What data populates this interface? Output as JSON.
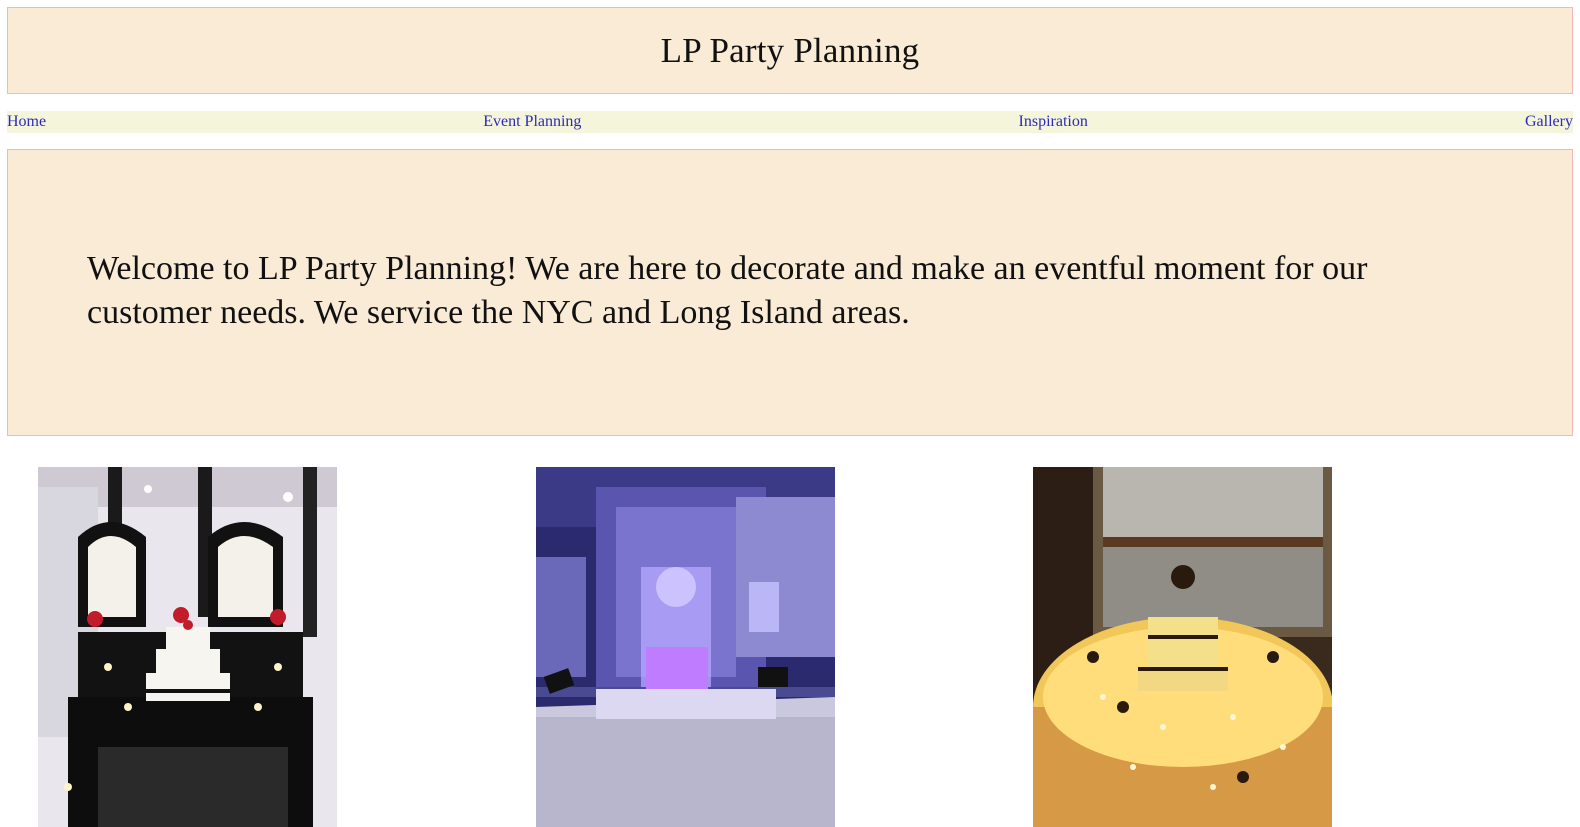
{
  "header": {
    "title": "LP Party Planning"
  },
  "nav": {
    "items": [
      {
        "label": "Home"
      },
      {
        "label": "Event Planning"
      },
      {
        "label": "Inspiration"
      },
      {
        "label": "Gallery"
      }
    ]
  },
  "welcome": {
    "text": "Welcome to LP Party Planning! We are here to decorate and make an eventful moment for our customer needs. We service the NYC and Long Island areas."
  },
  "colors": {
    "panel_bg": "#faebd7",
    "panel_border": "#f0b8b8",
    "nav_bg": "#f5f5dc",
    "link": "#2b2bb8"
  }
}
